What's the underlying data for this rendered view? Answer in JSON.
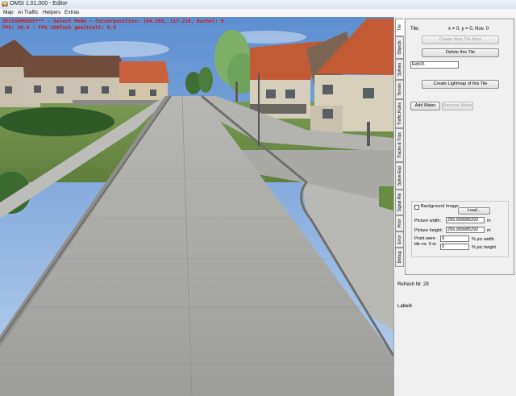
{
  "window": {
    "title": "OMSI 1.01.000 - Editor",
    "app_icon": "omsi-bus-icon"
  },
  "menu": [
    "Map",
    "AI Traffic",
    "Helpers",
    "Extras"
  ],
  "hud": {
    "line1": "DESIGNMODUS*** - Select Mode - Cursorposition: 194.593, 117.210, Kachel: 0",
    "line2": "FPS: 30.0 - FPS 100fach gemittelt: 0.0",
    "color": "#d51515"
  },
  "tabs": [
    "Tile",
    "Objects",
    "Splines",
    "Terrain",
    "Traffic Rules",
    "Tracks & Trips",
    "Spline-Exp",
    "Signal Rte",
    "Prior",
    "Error",
    "Debug"
  ],
  "active_tab": "Tile",
  "tile_panel": {
    "tile_label": "Tile:",
    "tile_coords": "x = 0, y = 0, Nov. 0",
    "create_new_tile": "Create New Tile Here",
    "delete_tile": "Delete this Tile",
    "tile_name_value": "Edit15",
    "create_lightmap": "Create Lightmap of this Tile",
    "add_water": "Add Water",
    "remove_water": "Remove Water",
    "background_image": {
      "checkbox_label": "Background Image:",
      "checked": false,
      "load_button": "Load...",
      "picture_width_label": "Picture width:",
      "picture_width_value": "299.999985292",
      "picture_width_unit": "m",
      "picture_height_label": "Picture height:",
      "picture_height_value": "299.999985292",
      "picture_height_unit": "m",
      "point_label_1": "Point were",
      "point_label_2": "tile no. 0 is:",
      "point_x_value": "0",
      "point_x_unit": "% pic width",
      "point_y_value": "0",
      "point_y_unit": "% pic height"
    }
  },
  "status": {
    "refresh": "Refresh Nr. 29",
    "label4": "Label4"
  },
  "colors": {
    "sky": "#6f9ed8",
    "road": "#a5a5a2",
    "grass": "#6e8f46",
    "roof": "#c05a35"
  }
}
